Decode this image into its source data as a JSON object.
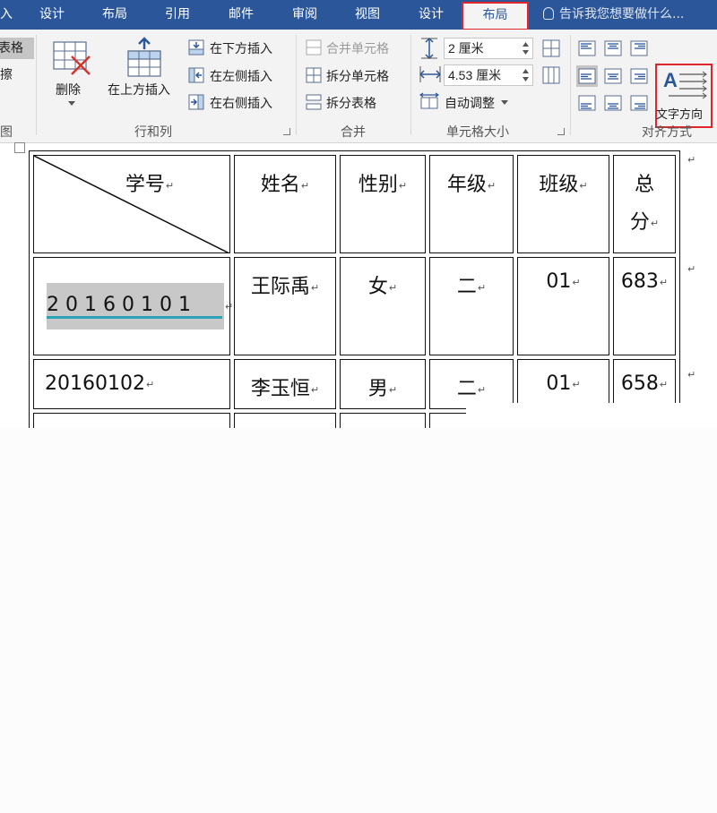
{
  "tabs": [
    {
      "label": "入"
    },
    {
      "label": "设计"
    },
    {
      "label": "布局"
    },
    {
      "label": "引用"
    },
    {
      "label": "邮件"
    },
    {
      "label": "审阅"
    },
    {
      "label": "视图"
    },
    {
      "label": "设计"
    },
    {
      "label": "布局"
    }
  ],
  "tell_me": "告诉我您想要做什么...",
  "ribbon": {
    "partial_group": {
      "item1": "表格",
      "item2": "擦",
      "label": "图"
    },
    "rows_cols": {
      "delete": "删除",
      "insert_above": "在上方插入",
      "insert_below": "在下方插入",
      "insert_left": "在左侧插入",
      "insert_right": "在右侧插入",
      "label": "行和列"
    },
    "merge": {
      "merge_cells": "合并单元格",
      "split_cells": "拆分单元格",
      "split_table": "拆分表格",
      "label": "合并"
    },
    "cell_size": {
      "height": "2 厘米",
      "width": "4.53 厘米",
      "autofit": "自动调整",
      "label": "单元格大小"
    },
    "alignment": {
      "text_direction": "文字方向",
      "label": "对齐方式"
    }
  },
  "table": {
    "header": [
      "学号",
      "姓名",
      "性别",
      "年级",
      "班级",
      "总分"
    ],
    "header_last": [
      "总",
      "分"
    ],
    "rows": [
      [
        "20160101",
        "王际禹",
        "女",
        "二",
        "01",
        "683"
      ],
      [
        "20160102",
        "李玉恒",
        "男",
        "二",
        "01",
        "658"
      ]
    ],
    "selected_number": "20160101"
  },
  "colors": {
    "accent": "#2b579a",
    "highlight_box": "#e0262b",
    "underline": "#2aa3b8"
  }
}
